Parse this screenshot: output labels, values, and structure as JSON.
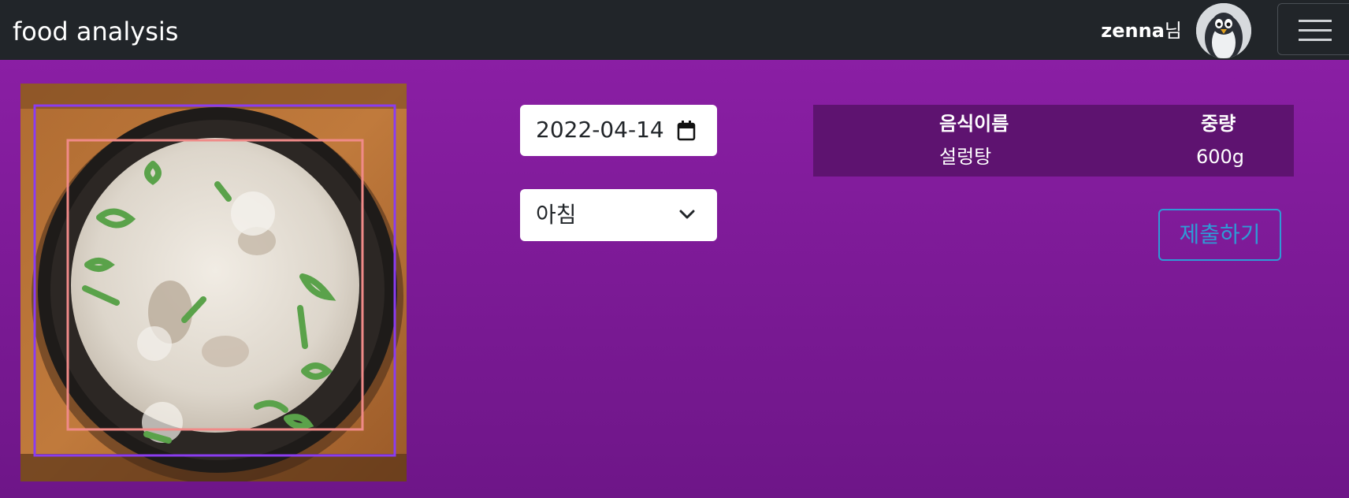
{
  "navbar": {
    "brand": "food analysis",
    "username": "zenna",
    "user_suffix": "님"
  },
  "form": {
    "date_value": "2022-04-14",
    "meal_value": "아침"
  },
  "table": {
    "headers": {
      "name": "음식이름",
      "weight": "중량"
    },
    "rows": [
      {
        "name": "설렁탕",
        "weight": "600g"
      }
    ]
  },
  "actions": {
    "submit_label": "제출하기"
  },
  "colors": {
    "navbar_bg": "#212529",
    "page_bg": "#8e20a8",
    "table_bg": "#5e1370",
    "submit_accent": "#2e9bd6",
    "detection_box_outer": "#8a3cf0",
    "detection_box_inner": "#f08a88"
  },
  "icons": {
    "avatar": "penguin-avatar",
    "menu": "hamburger-menu-icon",
    "calendar": "calendar-icon",
    "dropdown": "chevron-down-icon"
  }
}
